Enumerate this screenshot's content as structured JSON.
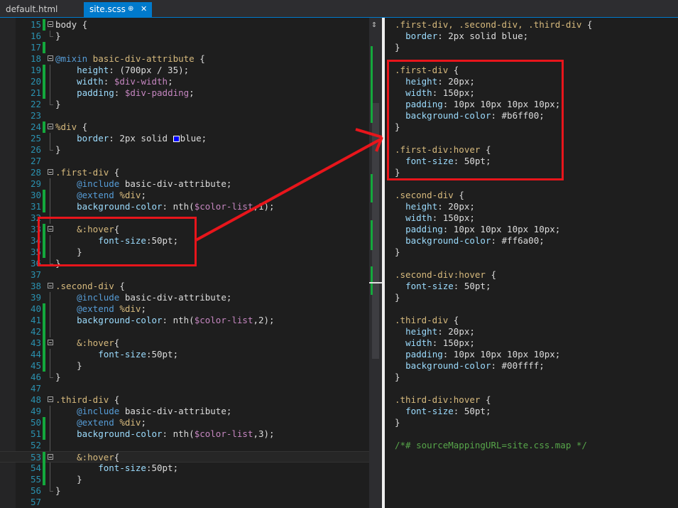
{
  "tabs": [
    {
      "label": "default.html",
      "active": false
    },
    {
      "label": "site.scss",
      "active": true
    }
  ],
  "tab_icons": {
    "pin": "⊕",
    "close": "✕"
  },
  "editor": {
    "lines": [
      {
        "n": "15",
        "changed": true,
        "fold": "open",
        "segs": [
          {
            "t": "body {",
            "c": ""
          }
        ]
      },
      {
        "n": "16",
        "changed": false,
        "fold": "end",
        "segs": [
          {
            "t": "}",
            "c": ""
          }
        ]
      },
      {
        "n": "17",
        "changed": true,
        "fold": "",
        "segs": []
      },
      {
        "n": "18",
        "changed": false,
        "fold": "open",
        "segs": [
          {
            "t": "@mixin",
            "c": "kw"
          },
          {
            "t": " basic-div-attribute",
            "c": "sel"
          },
          {
            "t": " {",
            "c": ""
          }
        ]
      },
      {
        "n": "19",
        "changed": true,
        "fold": "guide",
        "segs": [
          {
            "t": "    ",
            "c": ""
          },
          {
            "t": "height",
            "c": "prop"
          },
          {
            "t": ": (700px / 35);",
            "c": ""
          }
        ]
      },
      {
        "n": "20",
        "changed": true,
        "fold": "guide",
        "segs": [
          {
            "t": "    ",
            "c": ""
          },
          {
            "t": "width",
            "c": "prop"
          },
          {
            "t": ": ",
            "c": ""
          },
          {
            "t": "$div-width",
            "c": "var"
          },
          {
            "t": ";",
            "c": ""
          }
        ]
      },
      {
        "n": "21",
        "changed": true,
        "fold": "guide",
        "segs": [
          {
            "t": "    ",
            "c": ""
          },
          {
            "t": "padding",
            "c": "prop"
          },
          {
            "t": ": ",
            "c": ""
          },
          {
            "t": "$div-padding",
            "c": "var"
          },
          {
            "t": ";",
            "c": ""
          }
        ]
      },
      {
        "n": "22",
        "changed": false,
        "fold": "end",
        "segs": [
          {
            "t": "}",
            "c": ""
          }
        ]
      },
      {
        "n": "23",
        "changed": false,
        "fold": "",
        "segs": []
      },
      {
        "n": "24",
        "changed": true,
        "fold": "open",
        "segs": [
          {
            "t": "%div",
            "c": "sel"
          },
          {
            "t": " {",
            "c": ""
          }
        ]
      },
      {
        "n": "25",
        "changed": false,
        "fold": "guide",
        "segs": [
          {
            "t": "    ",
            "c": ""
          },
          {
            "t": "border",
            "c": "prop"
          },
          {
            "t": ": 2px solid ",
            "c": ""
          },
          {
            "t": "",
            "c": "swatch"
          },
          {
            "t": "blue;",
            "c": ""
          }
        ]
      },
      {
        "n": "26",
        "changed": false,
        "fold": "end",
        "segs": [
          {
            "t": "}",
            "c": ""
          }
        ]
      },
      {
        "n": "27",
        "changed": false,
        "fold": "",
        "segs": []
      },
      {
        "n": "28",
        "changed": false,
        "fold": "open",
        "segs": [
          {
            "t": ".first-div",
            "c": "sel"
          },
          {
            "t": " {",
            "c": ""
          }
        ]
      },
      {
        "n": "29",
        "changed": false,
        "fold": "guide",
        "segs": [
          {
            "t": "    ",
            "c": ""
          },
          {
            "t": "@include",
            "c": "kw"
          },
          {
            "t": " basic-div-attribute;",
            "c": ""
          }
        ]
      },
      {
        "n": "30",
        "changed": true,
        "fold": "guide",
        "segs": [
          {
            "t": "    ",
            "c": ""
          },
          {
            "t": "@extend",
            "c": "kw"
          },
          {
            "t": " ",
            "c": ""
          },
          {
            "t": "%div",
            "c": "sel"
          },
          {
            "t": ";",
            "c": ""
          }
        ]
      },
      {
        "n": "31",
        "changed": true,
        "fold": "guide",
        "segs": [
          {
            "t": "    ",
            "c": ""
          },
          {
            "t": "background-color",
            "c": "prop"
          },
          {
            "t": ": nth(",
            "c": ""
          },
          {
            "t": "$color-list",
            "c": "var"
          },
          {
            "t": ",1);",
            "c": ""
          }
        ]
      },
      {
        "n": "32",
        "changed": false,
        "fold": "guide",
        "segs": []
      },
      {
        "n": "33",
        "changed": true,
        "fold": "open",
        "segs": [
          {
            "t": "    ",
            "c": ""
          },
          {
            "t": "&:hover",
            "c": "sel"
          },
          {
            "t": "{",
            "c": ""
          }
        ]
      },
      {
        "n": "34",
        "changed": true,
        "fold": "guide",
        "segs": [
          {
            "t": "        ",
            "c": ""
          },
          {
            "t": "font-size",
            "c": "prop"
          },
          {
            "t": ":50pt;",
            "c": ""
          }
        ]
      },
      {
        "n": "35",
        "changed": true,
        "fold": "guide",
        "segs": [
          {
            "t": "    }",
            "c": ""
          }
        ]
      },
      {
        "n": "36",
        "changed": false,
        "fold": "end",
        "segs": [
          {
            "t": "}",
            "c": ""
          }
        ]
      },
      {
        "n": "37",
        "changed": false,
        "fold": "",
        "segs": []
      },
      {
        "n": "38",
        "changed": false,
        "fold": "open",
        "segs": [
          {
            "t": ".second-div",
            "c": "sel"
          },
          {
            "t": " {",
            "c": ""
          }
        ]
      },
      {
        "n": "39",
        "changed": false,
        "fold": "guide",
        "segs": [
          {
            "t": "    ",
            "c": ""
          },
          {
            "t": "@include",
            "c": "kw"
          },
          {
            "t": " basic-div-attribute;",
            "c": ""
          }
        ]
      },
      {
        "n": "40",
        "changed": true,
        "fold": "guide",
        "segs": [
          {
            "t": "    ",
            "c": ""
          },
          {
            "t": "@extend",
            "c": "kw"
          },
          {
            "t": " ",
            "c": ""
          },
          {
            "t": "%div",
            "c": "sel"
          },
          {
            "t": ";",
            "c": ""
          }
        ]
      },
      {
        "n": "41",
        "changed": true,
        "fold": "guide",
        "segs": [
          {
            "t": "    ",
            "c": ""
          },
          {
            "t": "background-color",
            "c": "prop"
          },
          {
            "t": ": nth(",
            "c": ""
          },
          {
            "t": "$color-list",
            "c": "var"
          },
          {
            "t": ",2);",
            "c": ""
          }
        ]
      },
      {
        "n": "42",
        "changed": true,
        "fold": "guide",
        "segs": []
      },
      {
        "n": "43",
        "changed": true,
        "fold": "open",
        "segs": [
          {
            "t": "    ",
            "c": ""
          },
          {
            "t": "&:hover",
            "c": "sel"
          },
          {
            "t": "{",
            "c": ""
          }
        ]
      },
      {
        "n": "44",
        "changed": true,
        "fold": "guide",
        "segs": [
          {
            "t": "        ",
            "c": ""
          },
          {
            "t": "font-size",
            "c": "prop"
          },
          {
            "t": ":50pt;",
            "c": ""
          }
        ]
      },
      {
        "n": "45",
        "changed": true,
        "fold": "guide",
        "segs": [
          {
            "t": "    }",
            "c": ""
          }
        ]
      },
      {
        "n": "46",
        "changed": false,
        "fold": "end",
        "segs": [
          {
            "t": "}",
            "c": ""
          }
        ]
      },
      {
        "n": "47",
        "changed": false,
        "fold": "",
        "segs": []
      },
      {
        "n": "48",
        "changed": false,
        "fold": "open",
        "segs": [
          {
            "t": ".third-div",
            "c": "sel"
          },
          {
            "t": " {",
            "c": ""
          }
        ]
      },
      {
        "n": "49",
        "changed": false,
        "fold": "guide",
        "segs": [
          {
            "t": "    ",
            "c": ""
          },
          {
            "t": "@include",
            "c": "kw"
          },
          {
            "t": " basic-div-attribute;",
            "c": ""
          }
        ]
      },
      {
        "n": "50",
        "changed": true,
        "fold": "guide",
        "segs": [
          {
            "t": "    ",
            "c": ""
          },
          {
            "t": "@extend",
            "c": "kw"
          },
          {
            "t": " ",
            "c": ""
          },
          {
            "t": "%div",
            "c": "sel"
          },
          {
            "t": ";",
            "c": ""
          }
        ]
      },
      {
        "n": "51",
        "changed": true,
        "fold": "guide",
        "segs": [
          {
            "t": "    ",
            "c": ""
          },
          {
            "t": "background-color",
            "c": "prop"
          },
          {
            "t": ": nth(",
            "c": ""
          },
          {
            "t": "$color-list",
            "c": "var"
          },
          {
            "t": ",3);",
            "c": ""
          }
        ]
      },
      {
        "n": "52",
        "changed": false,
        "fold": "guide",
        "segs": []
      },
      {
        "n": "53",
        "changed": true,
        "fold": "open",
        "active": true,
        "segs": [
          {
            "t": "    ",
            "c": ""
          },
          {
            "t": "&:hover",
            "c": "sel"
          },
          {
            "t": "{",
            "c": ""
          }
        ]
      },
      {
        "n": "54",
        "changed": true,
        "fold": "guide",
        "segs": [
          {
            "t": "        ",
            "c": ""
          },
          {
            "t": "font-size",
            "c": "prop"
          },
          {
            "t": ":50pt;",
            "c": ""
          }
        ]
      },
      {
        "n": "55",
        "changed": true,
        "fold": "guide",
        "segs": [
          {
            "t": "    }",
            "c": ""
          }
        ]
      },
      {
        "n": "56",
        "changed": false,
        "fold": "end",
        "segs": [
          {
            "t": "}",
            "c": ""
          }
        ]
      },
      {
        "n": "57",
        "changed": false,
        "fold": "",
        "segs": []
      }
    ]
  },
  "output": {
    "lines": [
      [
        {
          "t": ".first-div, .second-div, .third-div",
          "c": "sel"
        },
        {
          "t": " {",
          "c": ""
        }
      ],
      [
        {
          "t": "  ",
          "c": ""
        },
        {
          "t": "border",
          "c": "prop"
        },
        {
          "t": ": 2px solid blue;",
          "c": ""
        }
      ],
      [
        {
          "t": "}",
          "c": ""
        }
      ],
      [],
      [
        {
          "t": ".first-div",
          "c": "sel"
        },
        {
          "t": " {",
          "c": ""
        }
      ],
      [
        {
          "t": "  ",
          "c": ""
        },
        {
          "t": "height",
          "c": "prop"
        },
        {
          "t": ": 20px;",
          "c": ""
        }
      ],
      [
        {
          "t": "  ",
          "c": ""
        },
        {
          "t": "width",
          "c": "prop"
        },
        {
          "t": ": 150px;",
          "c": ""
        }
      ],
      [
        {
          "t": "  ",
          "c": ""
        },
        {
          "t": "padding",
          "c": "prop"
        },
        {
          "t": ": 10px 10px 10px 10px;",
          "c": ""
        }
      ],
      [
        {
          "t": "  ",
          "c": ""
        },
        {
          "t": "background-color",
          "c": "prop"
        },
        {
          "t": ": #b6ff00;",
          "c": ""
        }
      ],
      [
        {
          "t": "}",
          "c": ""
        }
      ],
      [],
      [
        {
          "t": ".first-div:hover",
          "c": "sel"
        },
        {
          "t": " {",
          "c": ""
        }
      ],
      [
        {
          "t": "  ",
          "c": ""
        },
        {
          "t": "font-size",
          "c": "prop"
        },
        {
          "t": ": 50pt;",
          "c": ""
        }
      ],
      [
        {
          "t": "}",
          "c": ""
        }
      ],
      [],
      [
        {
          "t": ".second-div",
          "c": "sel"
        },
        {
          "t": " {",
          "c": ""
        }
      ],
      [
        {
          "t": "  ",
          "c": ""
        },
        {
          "t": "height",
          "c": "prop"
        },
        {
          "t": ": 20px;",
          "c": ""
        }
      ],
      [
        {
          "t": "  ",
          "c": ""
        },
        {
          "t": "width",
          "c": "prop"
        },
        {
          "t": ": 150px;",
          "c": ""
        }
      ],
      [
        {
          "t": "  ",
          "c": ""
        },
        {
          "t": "padding",
          "c": "prop"
        },
        {
          "t": ": 10px 10px 10px 10px;",
          "c": ""
        }
      ],
      [
        {
          "t": "  ",
          "c": ""
        },
        {
          "t": "background-color",
          "c": "prop"
        },
        {
          "t": ": #ff6a00;",
          "c": ""
        }
      ],
      [
        {
          "t": "}",
          "c": ""
        }
      ],
      [],
      [
        {
          "t": ".second-div:hover",
          "c": "sel"
        },
        {
          "t": " {",
          "c": ""
        }
      ],
      [
        {
          "t": "  ",
          "c": ""
        },
        {
          "t": "font-size",
          "c": "prop"
        },
        {
          "t": ": 50pt;",
          "c": ""
        }
      ],
      [
        {
          "t": "}",
          "c": ""
        }
      ],
      [],
      [
        {
          "t": ".third-div",
          "c": "sel"
        },
        {
          "t": " {",
          "c": ""
        }
      ],
      [
        {
          "t": "  ",
          "c": ""
        },
        {
          "t": "height",
          "c": "prop"
        },
        {
          "t": ": 20px;",
          "c": ""
        }
      ],
      [
        {
          "t": "  ",
          "c": ""
        },
        {
          "t": "width",
          "c": "prop"
        },
        {
          "t": ": 150px;",
          "c": ""
        }
      ],
      [
        {
          "t": "  ",
          "c": ""
        },
        {
          "t": "padding",
          "c": "prop"
        },
        {
          "t": ": 10px 10px 10px 10px;",
          "c": ""
        }
      ],
      [
        {
          "t": "  ",
          "c": ""
        },
        {
          "t": "background-color",
          "c": "prop"
        },
        {
          "t": ": #00ffff;",
          "c": ""
        }
      ],
      [
        {
          "t": "}",
          "c": ""
        }
      ],
      [],
      [
        {
          "t": ".third-div:hover",
          "c": "sel"
        },
        {
          "t": " {",
          "c": ""
        }
      ],
      [
        {
          "t": "  ",
          "c": ""
        },
        {
          "t": "font-size",
          "c": "prop"
        },
        {
          "t": ": 50pt;",
          "c": ""
        }
      ],
      [
        {
          "t": "}",
          "c": ""
        }
      ],
      [],
      [
        {
          "t": "/*# sourceMappingURL=site.css.map */",
          "c": "com"
        }
      ]
    ]
  },
  "colors": {
    "accent": "#007acc",
    "annotation": "#e8151b",
    "change_marker": "#14a83c",
    "swatch_blue": "#0000ff"
  },
  "icons": {
    "split": "split-handle-icon"
  }
}
